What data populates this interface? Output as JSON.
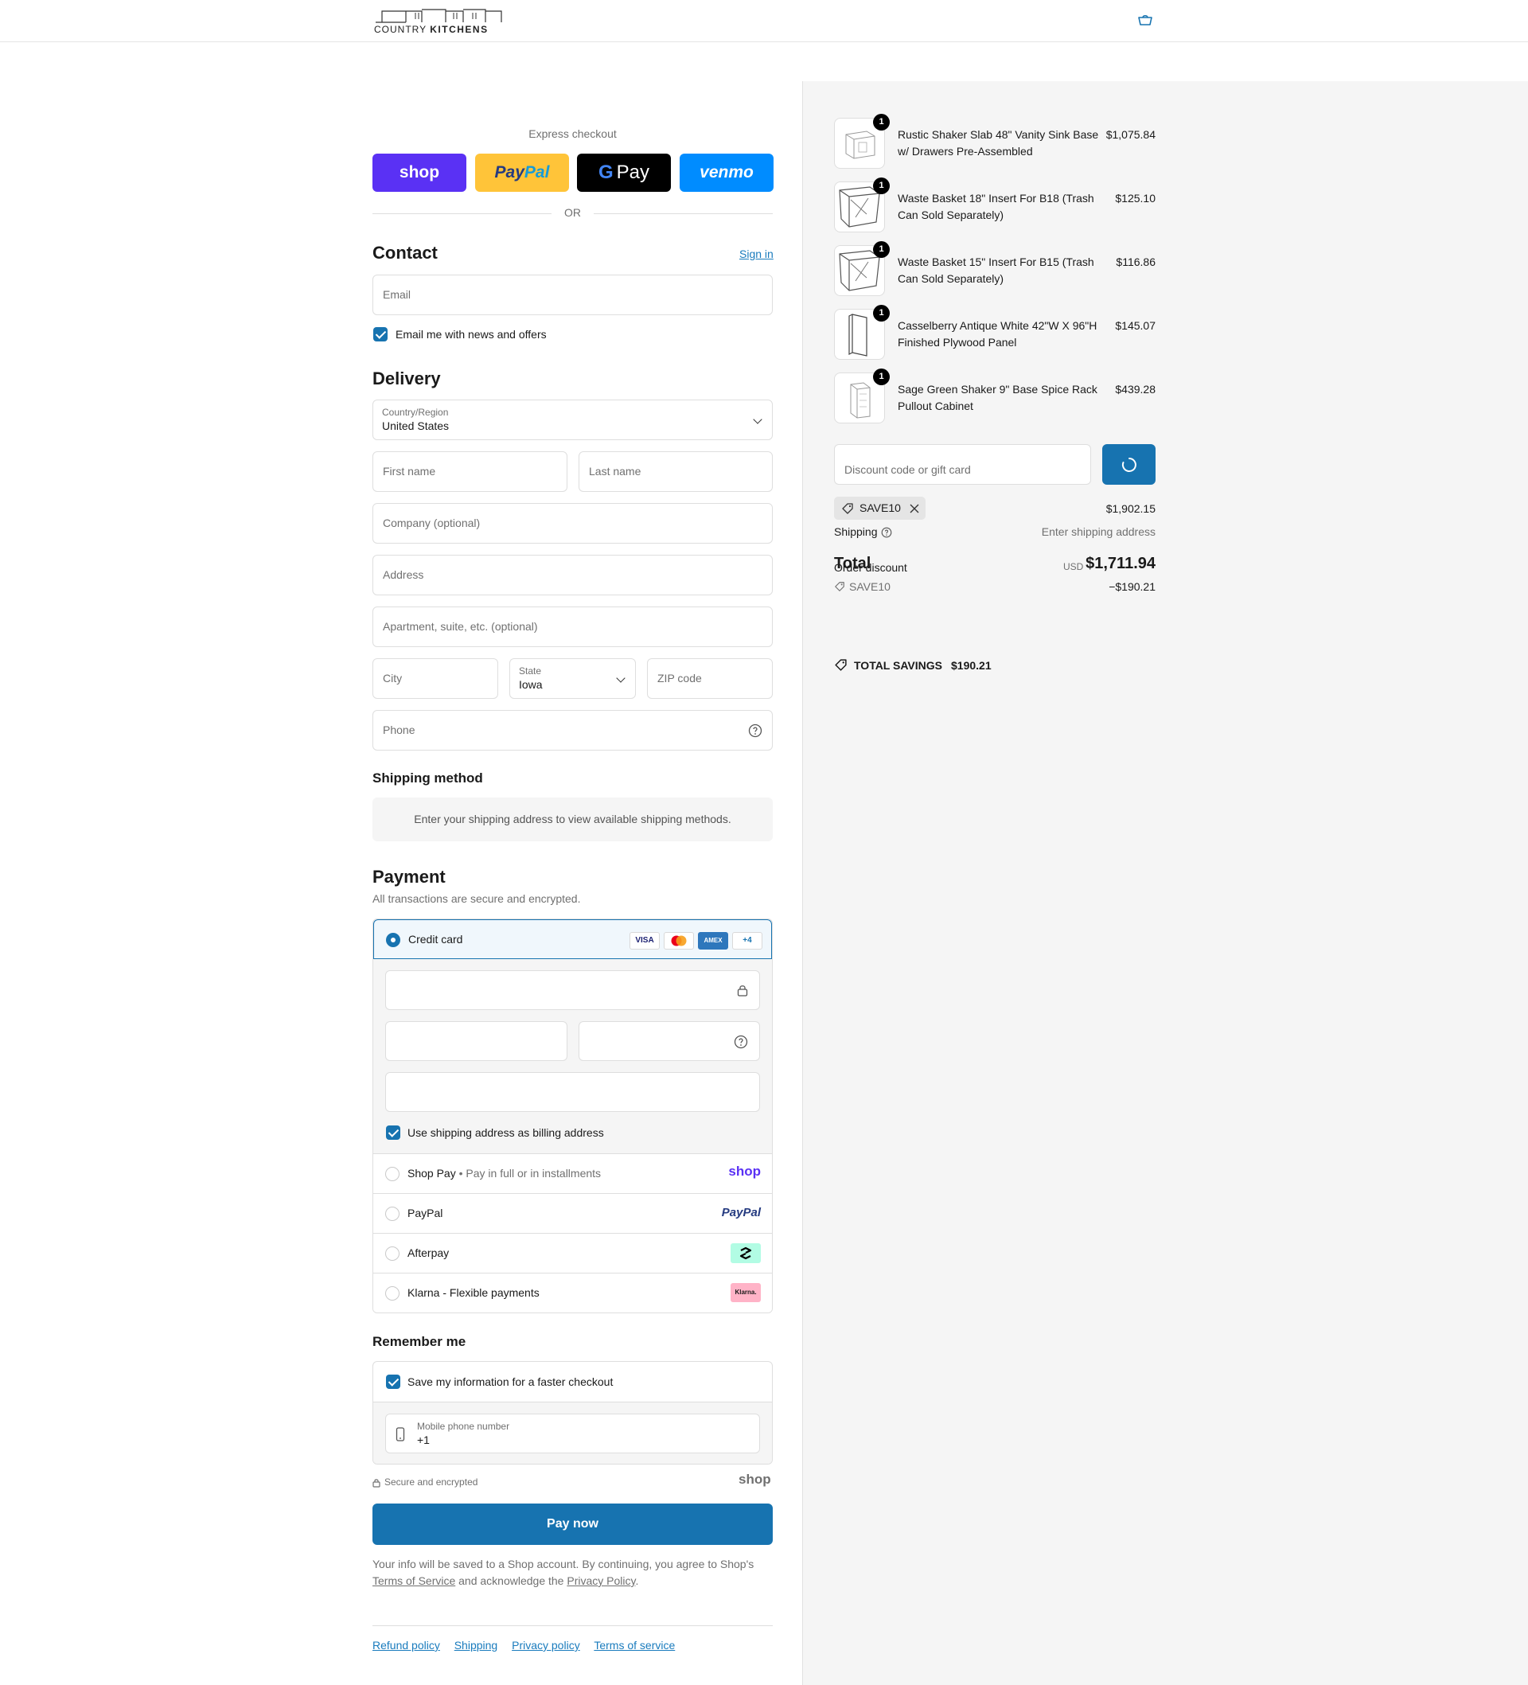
{
  "header": {
    "logo_text_a": "COUNTRY",
    "logo_text_b": "KITCHENS",
    "cart_icon": "bag-icon"
  },
  "express": {
    "label": "Express checkout",
    "shop": "shop",
    "paypal_a": "Pay",
    "paypal_b": "Pal",
    "gpay_g": "G",
    "gpay": "Pay",
    "venmo": "venmo",
    "or": "OR"
  },
  "contact": {
    "title": "Contact",
    "sign_in": "Sign in",
    "email_placeholder": "Email",
    "newsletter_label": "Email me with news and offers"
  },
  "delivery": {
    "title": "Delivery",
    "country_label": "Country/Region",
    "country_value": "United States",
    "first_name": "First name",
    "last_name": "Last name",
    "company": "Company (optional)",
    "address": "Address",
    "apartment": "Apartment, suite, etc. (optional)",
    "city": "City",
    "state_label": "State",
    "state_value": "Iowa",
    "zip": "ZIP code",
    "phone": "Phone"
  },
  "shipping_method": {
    "title": "Shipping method",
    "info": "Enter your shipping address to view available shipping methods."
  },
  "payment": {
    "title": "Payment",
    "subtitle": "All transactions are secure and encrypted.",
    "credit_card": "Credit card",
    "badges": [
      "VISA",
      "",
      "AMEX",
      "+4"
    ],
    "billing_label": "Use shipping address as billing address",
    "shop_pay": "Shop Pay",
    "shop_pay_sub": "Pay in full or in installments",
    "shop_pay_logo": "shop",
    "paypal": "PayPal",
    "paypal_logo": "PayPal",
    "afterpay": "Afterpay",
    "klarna": "Klarna - Flexible payments",
    "klarna_logo": "Klarna."
  },
  "remember": {
    "title": "Remember me",
    "save_label": "Save my information for a faster checkout",
    "mobile_label": "Mobile phone number",
    "mobile_value": "+1",
    "secure": "Secure and encrypted",
    "shop_logo": "shop"
  },
  "pay_now": "Pay now",
  "legal": {
    "text_a": "Your info will be saved to a Shop account. By continuing, you agree to Shop's ",
    "terms": "Terms of Service",
    "text_b": " and acknowledge the ",
    "privacy": "Privacy Policy",
    "text_c": "."
  },
  "footer": {
    "links": [
      "Refund policy",
      "Shipping",
      "Privacy policy",
      "Terms of service"
    ]
  },
  "summary": {
    "items": [
      {
        "name": "Rustic Shaker Slab 48\" Vanity Sink Base w/ Drawers Pre-Assembled",
        "qty": "1",
        "price": "$1,075.84"
      },
      {
        "name": "Waste Basket 18\" Insert For B18 (Trash Can Sold Separately)",
        "qty": "1",
        "price": "$125.10"
      },
      {
        "name": "Waste Basket 15\" Insert For B15 (Trash Can Sold Separately)",
        "qty": "1",
        "price": "$116.86"
      },
      {
        "name": "Casselberry Antique White 42\"W X 96\"H Finished Plywood Panel",
        "qty": "1",
        "price": "$145.07"
      },
      {
        "name": "Sage Green Shaker 9\" Base Spice Rack Pullout Cabinet",
        "qty": "1",
        "price": "$439.28"
      }
    ],
    "discount_placeholder": "Discount code or gift card",
    "code": "SAVE10",
    "subtotal": "$1,902.15",
    "shipping_label": "Shipping",
    "shipping_value": "Enter shipping address",
    "total_label": "Total",
    "order_discount": "Order discount",
    "currency": "USD",
    "total": "$1,711.94",
    "discount_code": "SAVE10",
    "discount_value": "−$190.21",
    "savings_label": "TOTAL SAVINGS",
    "savings_value": "$190.21"
  }
}
